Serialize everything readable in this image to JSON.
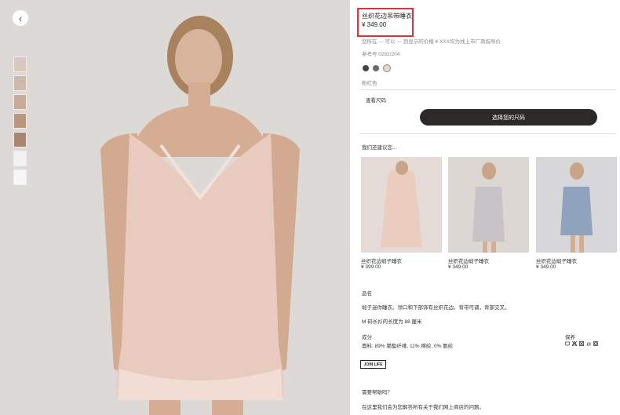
{
  "product": {
    "title": "丝织花边吊带睡衣",
    "price": "¥ 349.00",
    "price_note": "您所在 — 可以 — 到显示的价格 ¥ XXX均为线上市厂商指导价",
    "ref": "参考号 0292/204",
    "colors": [
      "#444444",
      "#6a6a6a",
      "#e8d6cf"
    ],
    "color_name": "粉红色",
    "size_guide": "查看尺码",
    "select_size": "选择您的尺码"
  },
  "recommend": {
    "heading": "我们还建议您...",
    "items": [
      {
        "name": "丝织花边缎子睡衣",
        "price": "¥ 399.00"
      },
      {
        "name": "丝织花边缎子睡衣",
        "price": "¥ 349.00"
      },
      {
        "name": "丝织花边缎子睡衣",
        "price": "¥ 349.00"
      }
    ]
  },
  "details": {
    "heading": "品名",
    "desc": "缎子迷你睡衣。领口和下部饰有丝织花边。背带可调，背部交叉。",
    "length": "M 码长衫的长度为 88 厘米",
    "composition_label": "成分",
    "composition": "面料: 89% 聚酯纤维, 11% 棉纶, 0% 氨纶",
    "care_label": "保养",
    "joinlife": "JOIN LIFE"
  },
  "help": {
    "heading": "需要帮助吗？",
    "text": "在这里我们会为您解答所有关于我们网上商店的问题。"
  },
  "icons": {
    "back": "chevron-left-icon"
  }
}
